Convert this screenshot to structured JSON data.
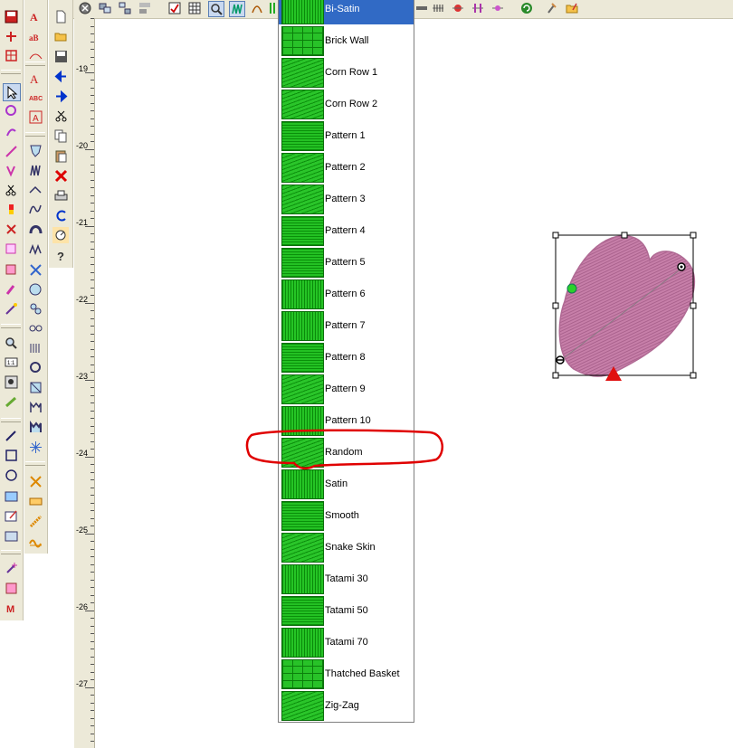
{
  "dropdown": {
    "items": [
      {
        "label": "Bi-Satin",
        "selected": true
      },
      {
        "label": "Brick Wall"
      },
      {
        "label": "Corn Row 1"
      },
      {
        "label": "Corn Row 2"
      },
      {
        "label": "Pattern  1"
      },
      {
        "label": "Pattern  2"
      },
      {
        "label": "Pattern  3"
      },
      {
        "label": "Pattern  4"
      },
      {
        "label": "Pattern  5"
      },
      {
        "label": "Pattern  6"
      },
      {
        "label": "Pattern  7"
      },
      {
        "label": "Pattern  8"
      },
      {
        "label": "Pattern  9"
      },
      {
        "label": "Pattern 10"
      },
      {
        "label": "Random",
        "highlighted": true
      },
      {
        "label": "Satin"
      },
      {
        "label": "Smooth"
      },
      {
        "label": "Snake Skin"
      },
      {
        "label": "Tatami 30"
      },
      {
        "label": "Tatami 50"
      },
      {
        "label": "Tatami 70"
      },
      {
        "label": "Thatched Basket"
      },
      {
        "label": "Zig-Zag"
      }
    ]
  },
  "ruler": {
    "labels": [
      "-19",
      "-20",
      "-21",
      "-22",
      "-23",
      "-24",
      "-25",
      "-26",
      "-27"
    ]
  },
  "colors": {
    "selection": "#316ac5",
    "annotation": "#e00000",
    "heart_fill": "#c77fa9",
    "swatch_green": "#16a816"
  },
  "icons": {
    "top_toolbar": [
      "stop-icon",
      "group-icon",
      "ungroup-icon",
      "align-icon",
      "view-icon",
      "grid-icon",
      "zoom-fit-icon",
      "stitch-icon",
      "outline-icon",
      "grid-toggle-icon",
      "stitch-type-a-icon",
      "stitch-type-b-icon",
      "stitch-type-c-icon",
      "stitch-type-d-icon",
      "stitch-type-e-icon",
      "refresh-icon",
      "wrench-icon",
      "folder-edit-icon"
    ],
    "left_tools": [
      "save-icon",
      "select-arrow-icon",
      "zoom-icon",
      "pen-icon",
      "rectangle-icon",
      "circle-icon"
    ]
  }
}
